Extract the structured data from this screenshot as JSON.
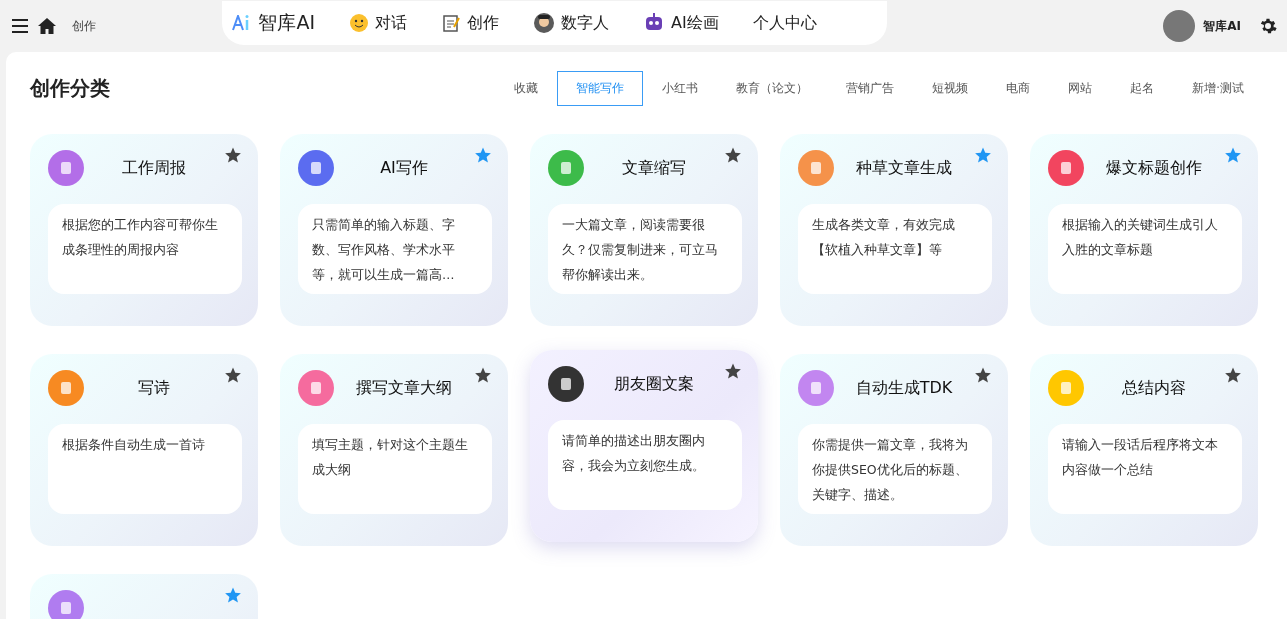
{
  "topbar": {
    "breadcrumb": "创作",
    "brand": "智库AI",
    "nav": [
      {
        "label": "对话",
        "kind": "face"
      },
      {
        "label": "创作",
        "kind": "note"
      },
      {
        "label": "数字人",
        "kind": "person"
      },
      {
        "label": "AI绘画",
        "kind": "robot"
      },
      {
        "label": "个人中心",
        "kind": "none"
      }
    ],
    "user": "智库AI"
  },
  "section": {
    "title": "创作分类",
    "tabs": [
      {
        "label": "收藏",
        "selected": false
      },
      {
        "label": "智能写作",
        "selected": true
      },
      {
        "label": "小红书",
        "selected": false
      },
      {
        "label": "教育（论文）",
        "selected": false
      },
      {
        "label": "营销广告",
        "selected": false
      },
      {
        "label": "短视频",
        "selected": false
      },
      {
        "label": "电商",
        "selected": false
      },
      {
        "label": "网站",
        "selected": false
      },
      {
        "label": "起名",
        "selected": false
      },
      {
        "label": "新增·测试",
        "selected": false
      }
    ]
  },
  "cards": [
    {
      "title": "工作周报",
      "description": "根据您的工作内容可帮你生成条理性的周报内容",
      "color": "#b36ee8",
      "favorited": false,
      "highlighted": false
    },
    {
      "title": "AI写作",
      "description": "只需简单的输入标题、字数、写作风格、学术水平等，就可以生成一篇高…",
      "color": "#5b6cf0",
      "favorited": true,
      "highlighted": false
    },
    {
      "title": "文章缩写",
      "description": "一大篇文章，阅读需要很久？仅需复制进来，可立马帮你解读出来。",
      "color": "#3dbb4a",
      "favorited": false,
      "highlighted": false
    },
    {
      "title": "种草文章生成",
      "description": "生成各类文章，有效完成【软植入种草文章】等",
      "color": "#f5924a",
      "favorited": true,
      "highlighted": false
    },
    {
      "title": "爆文标题创作",
      "description": "根据输入的关键词生成引人入胜的文章标题",
      "color": "#f2455f",
      "favorited": true,
      "highlighted": false
    },
    {
      "title": "写诗",
      "description": "根据条件自动生成一首诗",
      "color": "#f78a22",
      "favorited": false,
      "highlighted": false
    },
    {
      "title": "撰写文章大纲",
      "description": "填写主题，针对这个主题生成大纲",
      "color": "#f56b9e",
      "favorited": false,
      "highlighted": false
    },
    {
      "title": "朋友圈文案",
      "description": "请简单的描述出朋友圈内容，我会为立刻您生成。",
      "color": "#333333",
      "favorited": false,
      "highlighted": true
    },
    {
      "title": "自动生成TDK",
      "description": "你需提供一篇文章，我将为你提供SEO优化后的标题、关键字、描述。",
      "color": "#c286f0",
      "favorited": false,
      "highlighted": false
    },
    {
      "title": "总结内容",
      "description": "请输入一段话后程序将文本内容做一个总结",
      "color": "#ffc700",
      "favorited": false,
      "highlighted": false
    },
    {
      "color": "#b07cf0",
      "favorited": true,
      "highlighted": false
    }
  ]
}
